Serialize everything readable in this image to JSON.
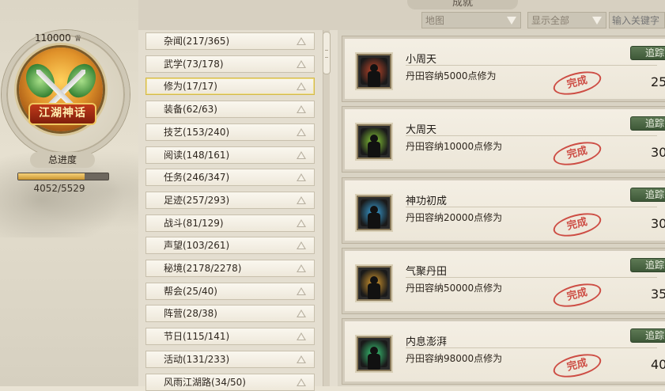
{
  "profile": {
    "score": "110000",
    "emblem_title": "江湖神话",
    "progress_label": "总进度",
    "progress_text": "4052/5529",
    "progress_fraction": 0.733
  },
  "top": {
    "title": "成就",
    "filter_category": "地图",
    "filter_display": "显示全部",
    "search_placeholder": "输入关键字"
  },
  "categories": [
    {
      "label": "杂闻(217/365)"
    },
    {
      "label": "武学(73/178)"
    },
    {
      "label": "修为(17/17)",
      "selected": true
    },
    {
      "label": "装备(62/63)"
    },
    {
      "label": "技艺(153/240)"
    },
    {
      "label": "阅读(148/161)"
    },
    {
      "label": "任务(246/347)"
    },
    {
      "label": "足迹(257/293)"
    },
    {
      "label": "战斗(81/129)"
    },
    {
      "label": "声望(103/261)"
    },
    {
      "label": "秘境(2178/2278)"
    },
    {
      "label": "帮会(25/40)"
    },
    {
      "label": "阵营(28/38)"
    },
    {
      "label": "节日(115/141)"
    },
    {
      "label": "活动(131/233)"
    },
    {
      "label": "风雨江湖路(34/50)"
    }
  ],
  "achievements": [
    {
      "name": "小周天",
      "desc": "丹田容纳5000点修为",
      "stamp": "完成",
      "track": "追踪",
      "points": "25",
      "glow": "#c8482a"
    },
    {
      "name": "大周天",
      "desc": "丹田容纳10000点修为",
      "stamp": "完成",
      "track": "追踪",
      "points": "30",
      "glow": "#8fd43a"
    },
    {
      "name": "神功初成",
      "desc": "丹田容纳20000点修为",
      "stamp": "完成",
      "track": "追踪",
      "points": "30",
      "glow": "#3aa6e0"
    },
    {
      "name": "气聚丹田",
      "desc": "丹田容纳50000点修为",
      "stamp": "完成",
      "track": "追踪",
      "points": "35",
      "glow": "#e0a030"
    },
    {
      "name": "内息澎湃",
      "desc": "丹田容纳98000点修为",
      "stamp": "完成",
      "track": "追踪",
      "points": "40",
      "glow": "#3ad07a"
    }
  ]
}
